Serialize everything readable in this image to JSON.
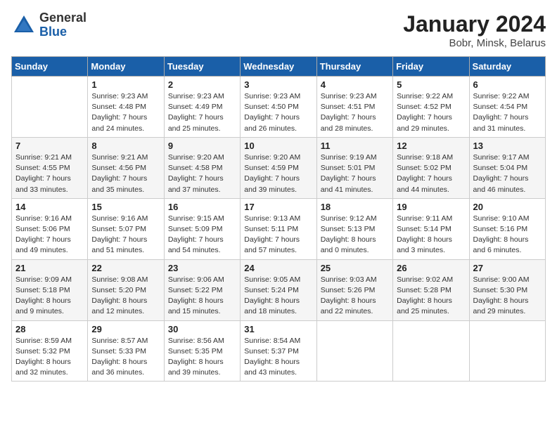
{
  "header": {
    "logo_general": "General",
    "logo_blue": "Blue",
    "month_year": "January 2024",
    "location": "Bobr, Minsk, Belarus"
  },
  "weekdays": [
    "Sunday",
    "Monday",
    "Tuesday",
    "Wednesday",
    "Thursday",
    "Friday",
    "Saturday"
  ],
  "weeks": [
    [
      {
        "day": "",
        "sunrise": "",
        "sunset": "",
        "daylight": ""
      },
      {
        "day": "1",
        "sunrise": "Sunrise: 9:23 AM",
        "sunset": "Sunset: 4:48 PM",
        "daylight": "Daylight: 7 hours and 24 minutes."
      },
      {
        "day": "2",
        "sunrise": "Sunrise: 9:23 AM",
        "sunset": "Sunset: 4:49 PM",
        "daylight": "Daylight: 7 hours and 25 minutes."
      },
      {
        "day": "3",
        "sunrise": "Sunrise: 9:23 AM",
        "sunset": "Sunset: 4:50 PM",
        "daylight": "Daylight: 7 hours and 26 minutes."
      },
      {
        "day": "4",
        "sunrise": "Sunrise: 9:23 AM",
        "sunset": "Sunset: 4:51 PM",
        "daylight": "Daylight: 7 hours and 28 minutes."
      },
      {
        "day": "5",
        "sunrise": "Sunrise: 9:22 AM",
        "sunset": "Sunset: 4:52 PM",
        "daylight": "Daylight: 7 hours and 29 minutes."
      },
      {
        "day": "6",
        "sunrise": "Sunrise: 9:22 AM",
        "sunset": "Sunset: 4:54 PM",
        "daylight": "Daylight: 7 hours and 31 minutes."
      }
    ],
    [
      {
        "day": "7",
        "sunrise": "Sunrise: 9:21 AM",
        "sunset": "Sunset: 4:55 PM",
        "daylight": "Daylight: 7 hours and 33 minutes."
      },
      {
        "day": "8",
        "sunrise": "Sunrise: 9:21 AM",
        "sunset": "Sunset: 4:56 PM",
        "daylight": "Daylight: 7 hours and 35 minutes."
      },
      {
        "day": "9",
        "sunrise": "Sunrise: 9:20 AM",
        "sunset": "Sunset: 4:58 PM",
        "daylight": "Daylight: 7 hours and 37 minutes."
      },
      {
        "day": "10",
        "sunrise": "Sunrise: 9:20 AM",
        "sunset": "Sunset: 4:59 PM",
        "daylight": "Daylight: 7 hours and 39 minutes."
      },
      {
        "day": "11",
        "sunrise": "Sunrise: 9:19 AM",
        "sunset": "Sunset: 5:01 PM",
        "daylight": "Daylight: 7 hours and 41 minutes."
      },
      {
        "day": "12",
        "sunrise": "Sunrise: 9:18 AM",
        "sunset": "Sunset: 5:02 PM",
        "daylight": "Daylight: 7 hours and 44 minutes."
      },
      {
        "day": "13",
        "sunrise": "Sunrise: 9:17 AM",
        "sunset": "Sunset: 5:04 PM",
        "daylight": "Daylight: 7 hours and 46 minutes."
      }
    ],
    [
      {
        "day": "14",
        "sunrise": "Sunrise: 9:16 AM",
        "sunset": "Sunset: 5:06 PM",
        "daylight": "Daylight: 7 hours and 49 minutes."
      },
      {
        "day": "15",
        "sunrise": "Sunrise: 9:16 AM",
        "sunset": "Sunset: 5:07 PM",
        "daylight": "Daylight: 7 hours and 51 minutes."
      },
      {
        "day": "16",
        "sunrise": "Sunrise: 9:15 AM",
        "sunset": "Sunset: 5:09 PM",
        "daylight": "Daylight: 7 hours and 54 minutes."
      },
      {
        "day": "17",
        "sunrise": "Sunrise: 9:13 AM",
        "sunset": "Sunset: 5:11 PM",
        "daylight": "Daylight: 7 hours and 57 minutes."
      },
      {
        "day": "18",
        "sunrise": "Sunrise: 9:12 AM",
        "sunset": "Sunset: 5:13 PM",
        "daylight": "Daylight: 8 hours and 0 minutes."
      },
      {
        "day": "19",
        "sunrise": "Sunrise: 9:11 AM",
        "sunset": "Sunset: 5:14 PM",
        "daylight": "Daylight: 8 hours and 3 minutes."
      },
      {
        "day": "20",
        "sunrise": "Sunrise: 9:10 AM",
        "sunset": "Sunset: 5:16 PM",
        "daylight": "Daylight: 8 hours and 6 minutes."
      }
    ],
    [
      {
        "day": "21",
        "sunrise": "Sunrise: 9:09 AM",
        "sunset": "Sunset: 5:18 PM",
        "daylight": "Daylight: 8 hours and 9 minutes."
      },
      {
        "day": "22",
        "sunrise": "Sunrise: 9:08 AM",
        "sunset": "Sunset: 5:20 PM",
        "daylight": "Daylight: 8 hours and 12 minutes."
      },
      {
        "day": "23",
        "sunrise": "Sunrise: 9:06 AM",
        "sunset": "Sunset: 5:22 PM",
        "daylight": "Daylight: 8 hours and 15 minutes."
      },
      {
        "day": "24",
        "sunrise": "Sunrise: 9:05 AM",
        "sunset": "Sunset: 5:24 PM",
        "daylight": "Daylight: 8 hours and 18 minutes."
      },
      {
        "day": "25",
        "sunrise": "Sunrise: 9:03 AM",
        "sunset": "Sunset: 5:26 PM",
        "daylight": "Daylight: 8 hours and 22 minutes."
      },
      {
        "day": "26",
        "sunrise": "Sunrise: 9:02 AM",
        "sunset": "Sunset: 5:28 PM",
        "daylight": "Daylight: 8 hours and 25 minutes."
      },
      {
        "day": "27",
        "sunrise": "Sunrise: 9:00 AM",
        "sunset": "Sunset: 5:30 PM",
        "daylight": "Daylight: 8 hours and 29 minutes."
      }
    ],
    [
      {
        "day": "28",
        "sunrise": "Sunrise: 8:59 AM",
        "sunset": "Sunset: 5:32 PM",
        "daylight": "Daylight: 8 hours and 32 minutes."
      },
      {
        "day": "29",
        "sunrise": "Sunrise: 8:57 AM",
        "sunset": "Sunset: 5:33 PM",
        "daylight": "Daylight: 8 hours and 36 minutes."
      },
      {
        "day": "30",
        "sunrise": "Sunrise: 8:56 AM",
        "sunset": "Sunset: 5:35 PM",
        "daylight": "Daylight: 8 hours and 39 minutes."
      },
      {
        "day": "31",
        "sunrise": "Sunrise: 8:54 AM",
        "sunset": "Sunset: 5:37 PM",
        "daylight": "Daylight: 8 hours and 43 minutes."
      },
      {
        "day": "",
        "sunrise": "",
        "sunset": "",
        "daylight": ""
      },
      {
        "day": "",
        "sunrise": "",
        "sunset": "",
        "daylight": ""
      },
      {
        "day": "",
        "sunrise": "",
        "sunset": "",
        "daylight": ""
      }
    ]
  ]
}
